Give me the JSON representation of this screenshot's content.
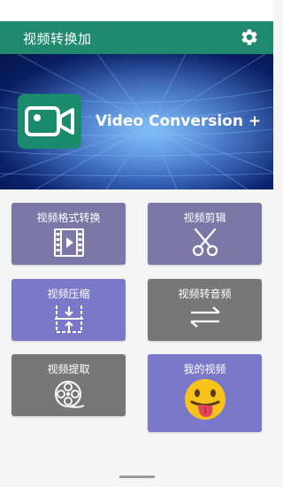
{
  "app_bar": {
    "title": "视频转换加",
    "settings_icon": "gear-icon"
  },
  "banner": {
    "text": "Video Conversion +",
    "logo_icon": "video-camera-icon"
  },
  "tiles": [
    {
      "label": "视频格式转换",
      "icon": "film-icon",
      "color": "#7b78a8"
    },
    {
      "label": "视频剪辑",
      "icon": "scissors-icon",
      "color": "#7b78a8"
    },
    {
      "label": "视频压缩",
      "icon": "compress-icon",
      "color": "#7a78c9"
    },
    {
      "label": "视频转音频",
      "icon": "swap-arrows-icon",
      "color": "#777777"
    },
    {
      "label": "视频提取",
      "icon": "film-reel-icon",
      "color": "#777777"
    },
    {
      "label": "我的视频",
      "icon": "tongue-out-emoji-icon",
      "color": "#7a78c9"
    }
  ],
  "colors": {
    "app_bar": "#1f8a6d",
    "background": "#f5f5f5"
  }
}
